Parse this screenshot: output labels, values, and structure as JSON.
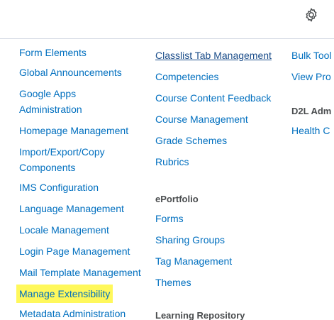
{
  "header": {
    "settings_icon": "gear-icon"
  },
  "col1": {
    "items": [
      "Form Elements",
      "Global Announcements",
      "Google Apps Administration",
      "Homepage Management",
      "Import/Export/Copy Components",
      "IMS Configuration",
      "Language Management",
      "Locale Management",
      "Login Page Management",
      "Mail Template Management",
      "Manage Extensibility",
      "Metadata Administration"
    ]
  },
  "col2": {
    "items": [
      "Classlist Tab Management",
      "Competencies",
      "Course Content Feedback",
      "Course Management",
      "Grade Schemes",
      "Rubrics"
    ],
    "eportfolio": {
      "heading": "ePortfolio",
      "items": [
        "Forms",
        "Sharing Groups",
        "Tag Management",
        "Themes"
      ]
    },
    "lr_heading": "Learning Repository"
  },
  "col3": {
    "items": [
      "Bulk Tool",
      "View Pro"
    ],
    "heading": "D2L Adm",
    "items2": [
      "Health C"
    ]
  },
  "colors": {
    "link": "#006fbf",
    "highlight": "#fff85b",
    "heading": "#494c4e"
  }
}
